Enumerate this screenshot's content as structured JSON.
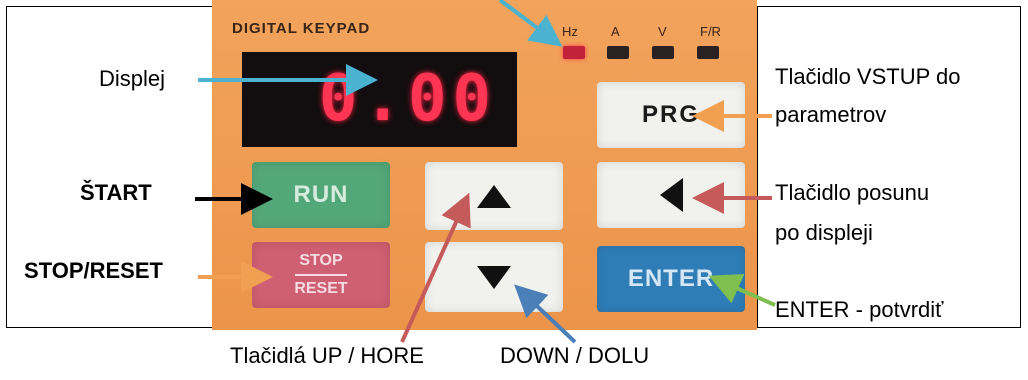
{
  "keypad": {
    "title": "DIGITAL KEYPAD",
    "indicators": [
      "Hz",
      "A",
      "V",
      "F/R"
    ],
    "display_value": "0.00",
    "keys": {
      "prg": "PRG",
      "run": "RUN",
      "stop": "STOP",
      "reset": "RESET",
      "enter": "ENTER"
    }
  },
  "annotations": {
    "display": "Displej",
    "start": "ŠTART",
    "stop_reset": "STOP/RESET",
    "prg_line1": "Tlačidlo VSTUP do",
    "prg_line2": "parametrov",
    "shift_line1": "Tlačidlo posunu",
    "shift_line2": "po displeji",
    "enter": "ENTER - potvrdiť",
    "up": "Tlačidlá  UP / HORE",
    "down": "DOWN / DOLU"
  },
  "colors": {
    "panel": "#ee9a52",
    "led_on": "#c2233a",
    "display_digits": "#ff3553",
    "arrow_display": "#4bb3d0",
    "arrow_start": "#000000",
    "arrow_stop": "#f0a050",
    "arrow_prg": "#f0a050",
    "arrow_shift": "#c55a5a",
    "arrow_enter": "#7fbf4f",
    "arrow_up": "#c55a5a",
    "arrow_down": "#4a7fb8",
    "arrow_hz": "#4bb3d0"
  },
  "icons": [
    "up-triangle-icon",
    "down-triangle-icon",
    "left-triangle-icon"
  ]
}
